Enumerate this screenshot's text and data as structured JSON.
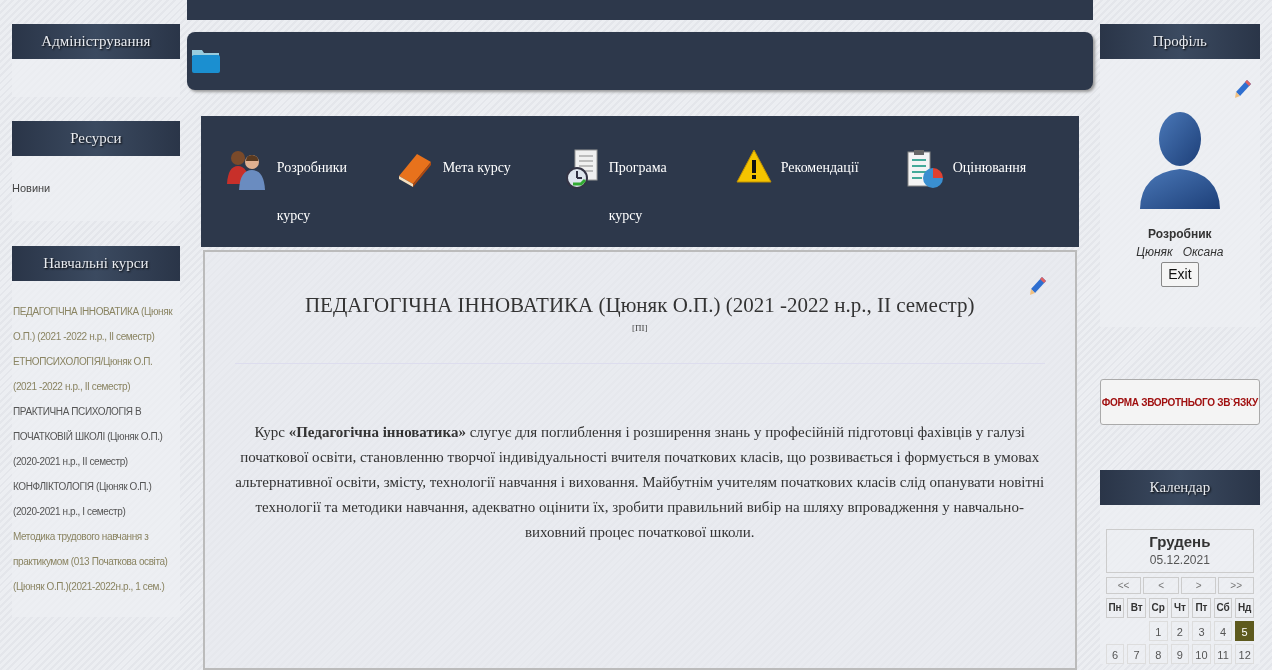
{
  "left_sidebar": {
    "admin": {
      "title": "Адміністрування"
    },
    "resources": {
      "title": "Ресурси",
      "items": [
        "Новини"
      ]
    },
    "courses": {
      "title": "Навчальні курси",
      "items": [
        {
          "label": "ПЕДАГОГІЧНА ІННОВАТИКА (Цюняк О.П.) (2021 -2022 н.р., ІІ семестр)",
          "color": "#8a8462"
        },
        {
          "label": "ЕТНОПСИХОЛОГІЯ/Цюняк О.П. (2021 -2022 н.р., ІІ семестр)",
          "color": "#8a8462"
        },
        {
          "label": "ПРАКТИЧНА ПСИХОЛОГІЯ В ПОЧАТКОВІЙ ШКОЛІ (Цюняк О.П.) (2020-2021 н.р., ІІ семестр)",
          "color": "#555555"
        },
        {
          "label": "КОНФЛІКТОЛОГІЯ (Цюняк О.П.) (2020-2021 н.р., І семестр)",
          "color": "#555555"
        },
        {
          "label": "Методика трудового навчання з практикумом (013 Початкова освіта) (Цюняк О.П.)(2021-2022н.р., 1 сем.)",
          "color": "#8a8462"
        }
      ]
    }
  },
  "course_nav": [
    {
      "kind": "people",
      "label": "Розробники курсу"
    },
    {
      "kind": "book",
      "label": "Мета курсу"
    },
    {
      "kind": "program",
      "label": "Програма курсу"
    },
    {
      "kind": "warning",
      "label": "Рекомендації"
    },
    {
      "kind": "grading",
      "label": "Оцінювання"
    }
  ],
  "course": {
    "title": "ПЕДАГОГІЧНА ІННОВАТИКА (Цюняк О.П.) (2021 -2022 н.р., ІІ семестр)",
    "code": "[ПІ]",
    "description": "Курс **«Педагогічна інноватика»** слугує для поглиблення і розширення знань у професійній підготовці фахівців у галузі початкової освіти, становленню творчої індивідуальності вчителя початкових класів, що розвивається і формується в умовах альтернативної освіти, змісту, технології навчання і виховання. Майбутнім учителям початкових класів слід опанувати новітні технології та методики  навчання, адекватно оцінити їх, зробити правильний вибір на шляху впровадження  у навчально-виховний процес початкової школи."
  },
  "profile": {
    "title": "Профіль",
    "role": "Розробник",
    "name": "Цюняк   Оксана",
    "exit": "Exit"
  },
  "feedback_button": "ФОРМА ЗВОРОТНЬОГО ЗВ`ЯЗКУ",
  "calendar": {
    "title": "Календар",
    "month": "Грудень",
    "date": "05.12.2021",
    "nav": [
      "<<",
      "<",
      ">",
      ">>"
    ],
    "weekdays": [
      "Пн",
      "Вт",
      "Ср",
      "Чт",
      "Пт",
      "Сб",
      "Нд"
    ],
    "weeks": [
      [
        {
          "kind": "empty"
        },
        {
          "kind": "empty"
        },
        {
          "kind": "day",
          "day": "1",
          "selected": false
        },
        {
          "kind": "day",
          "day": "2",
          "selected": false
        },
        {
          "kind": "day",
          "day": "3",
          "selected": false
        },
        {
          "kind": "day",
          "day": "4",
          "selected": false
        },
        {
          "kind": "day",
          "day": "5",
          "selected": true
        }
      ],
      [
        {
          "kind": "day",
          "day": "6",
          "selected": false
        },
        {
          "kind": "day",
          "day": "7",
          "selected": false
        },
        {
          "kind": "day",
          "day": "8",
          "selected": false
        },
        {
          "kind": "day",
          "day": "9",
          "selected": false
        },
        {
          "kind": "day",
          "day": "10",
          "selected": false
        },
        {
          "kind": "day",
          "day": "11",
          "selected": false
        },
        {
          "kind": "day",
          "day": "12",
          "selected": false
        }
      ]
    ]
  }
}
